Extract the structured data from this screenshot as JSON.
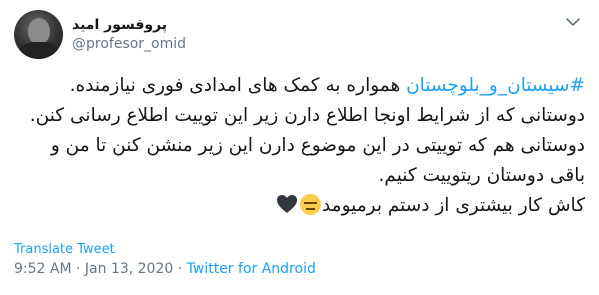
{
  "user": {
    "display_name": "پروفسور امید",
    "handle": "@profesor_omid",
    "avatar_icon": "user-avatar-photo"
  },
  "menu": {
    "icon": "chevron-down-icon"
  },
  "tweet": {
    "hashtag": "#سیستان_و_بلوچستان",
    "line1_rest": " همواره به کمک های امدادی فوری نیازمنده.",
    "line2": "دوستانی که از شرایط اونجا اطلاع دارن زیر این توییت اطلاع رسانی کنن.",
    "line3": "دوستانی هم که توییتی در این موضوع دارن این زیر منشن کنن تا من و",
    "line4": "باقی دوستان ریتوییت کنیم.",
    "line5": "کاش کار بیشتری از دستم برمیومد",
    "emojis": [
      "neutral-face-emoji",
      "black-heart-emoji"
    ]
  },
  "translate_label": "Translate Tweet",
  "meta": {
    "time": "9:52 AM",
    "separator": " · ",
    "date": "Jan 13, 2020",
    "source": "Twitter for Android"
  },
  "colors": {
    "link": "#1da1f2",
    "secondary": "#657786",
    "text": "#14171a"
  }
}
